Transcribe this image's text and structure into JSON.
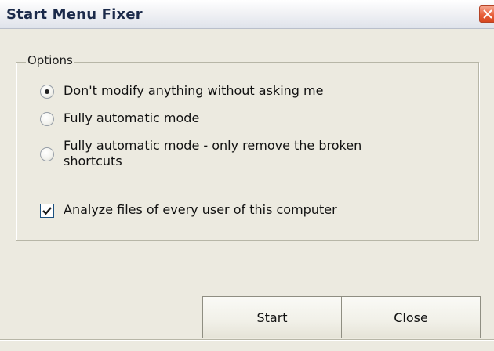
{
  "window": {
    "title": "Start Menu Fixer",
    "close_icon": "close-icon",
    "close_color": "#e8603c"
  },
  "options": {
    "group_label": "Options",
    "radios": [
      {
        "label": "Don't modify anything without asking me",
        "selected": true
      },
      {
        "label": "Fully automatic mode",
        "selected": false
      },
      {
        "label": "Fully automatic mode - only remove the broken shortcuts",
        "selected": false
      }
    ],
    "checkbox": {
      "label": "Analyze files of every user of this computer",
      "checked": true
    }
  },
  "buttons": {
    "start_label": "Start",
    "close_label": "Close"
  }
}
